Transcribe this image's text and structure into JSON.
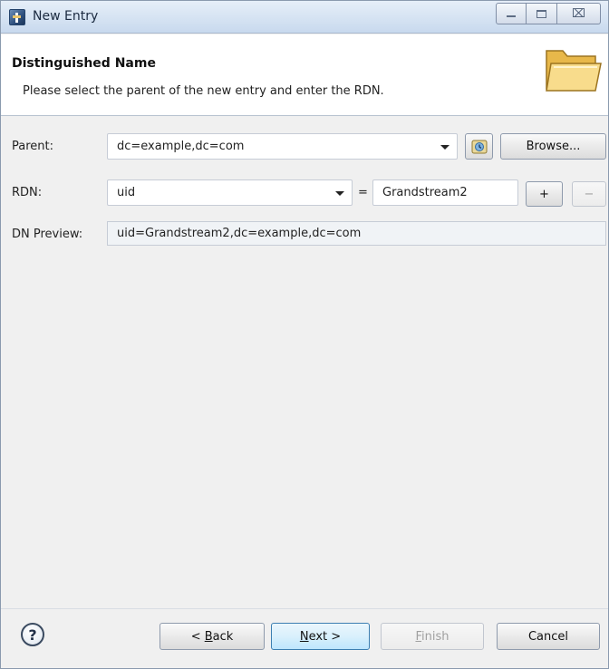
{
  "window": {
    "title": "New Entry",
    "icons": {
      "app": "app-icon",
      "minimize": "minimize-icon",
      "maximize": "maximize-icon",
      "close": "close-icon"
    },
    "close_glyph": "⌧"
  },
  "banner": {
    "title": "Distinguished Name",
    "description": "Please select the parent of the new entry and enter the RDN.",
    "icon": "folder-icon"
  },
  "form": {
    "parent": {
      "label": "Parent:",
      "value": "dc=example,dc=com",
      "history_icon": "history-icon",
      "browse_label": "Browse..."
    },
    "rdn": {
      "label": "RDN:",
      "attribute": "uid",
      "equals": "=",
      "value": "Grandstream2",
      "add_label": "+",
      "remove_label": "−"
    },
    "preview": {
      "label": "DN Preview:",
      "value": "uid=Grandstream2,dc=example,dc=com"
    }
  },
  "footer": {
    "help_glyph": "?",
    "back": {
      "prefix": "< ",
      "mnemonic": "B",
      "rest": "ack"
    },
    "next": {
      "mnemonic": "N",
      "rest": "ext >"
    },
    "finish": {
      "mnemonic": "F",
      "rest": "inish",
      "enabled": false
    },
    "cancel_label": "Cancel"
  },
  "colors": {
    "title_bar": "#d7e4f3",
    "default_button": "#bee6fd",
    "disabled_text": "#a0a0a0"
  }
}
